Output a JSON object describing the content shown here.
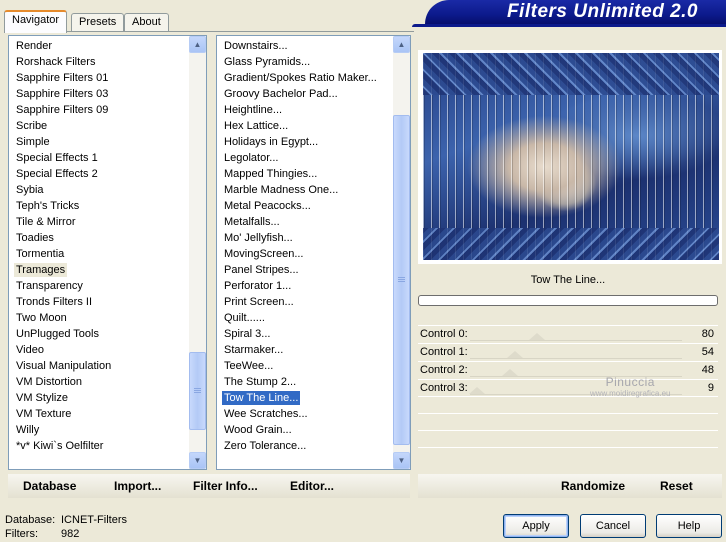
{
  "tabs": [
    "Navigator",
    "Presets",
    "About"
  ],
  "banner_title": "Filters Unlimited 2.0",
  "categories": [
    "Render",
    "Rorshack Filters",
    "Sapphire Filters 01",
    "Sapphire Filters 03",
    "Sapphire Filters 09",
    "Scribe",
    "Simple",
    "Special Effects 1",
    "Special Effects 2",
    "Sybia",
    "Teph's Tricks",
    "Tile & Mirror",
    "Toadies",
    "Tormentia",
    "Tramages",
    "Transparency",
    "Tronds Filters II",
    "Two Moon",
    "UnPlugged Tools",
    "Video",
    "Visual Manipulation",
    "VM Distortion",
    "VM Stylize",
    "VM Texture",
    "Willy",
    "*v* Kiwi`s Oelfilter"
  ],
  "current_category": "Tramages",
  "category_scroll_fraction": 0.93,
  "filters": [
    "Downstairs...",
    "Glass Pyramids...",
    "Gradient/Spokes Ratio Maker...",
    "Groovy Bachelor Pad...",
    "Heightline...",
    "Hex Lattice...",
    "Holidays in Egypt...",
    "Legolator...",
    "Mapped Thingies...",
    "Marble Madness One...",
    "Metal Peacocks...",
    "Metalfalls...",
    "Mo' Jellyfish...",
    "MovingScreen...",
    "Panel Stripes...",
    "Perforator 1...",
    "Print Screen...",
    "Quilt......",
    "Spiral 3...",
    "Starmaker...",
    "TeeWee...",
    "The Stump 2...",
    "Tow The Line...",
    "Wee Scratches...",
    "Wood Grain...",
    "Zero Tolerance..."
  ],
  "selected_filter": "Tow The Line...",
  "filter_scroll_fraction": 0.9,
  "preview_filter_name": "Tow The Line...",
  "controls": [
    {
      "label": "Control 0:",
      "value": 80
    },
    {
      "label": "Control 1:",
      "value": 54
    },
    {
      "label": "Control 2:",
      "value": 48
    },
    {
      "label": "Control 3:",
      "value": 9
    }
  ],
  "watermark": {
    "line1": "Pinuccia",
    "line2": "www.moidiregrafica.eu"
  },
  "links": [
    "Database",
    "Import...",
    "Filter Info...",
    "Editor...",
    "Randomize",
    "Reset"
  ],
  "status": {
    "database_label": "Database:",
    "database_value": "ICNET-Filters",
    "filters_label": "Filters:",
    "filters_value": "982"
  },
  "buttons": {
    "apply": "Apply",
    "cancel": "Cancel",
    "help": "Help"
  },
  "colors": {
    "selection": "#316ac5",
    "banner": "#0c1a8c",
    "dialog_bg": "#ece9d8"
  },
  "icons": {
    "scroll_up": "chevron-up-icon",
    "scroll_down": "chevron-down-icon"
  }
}
